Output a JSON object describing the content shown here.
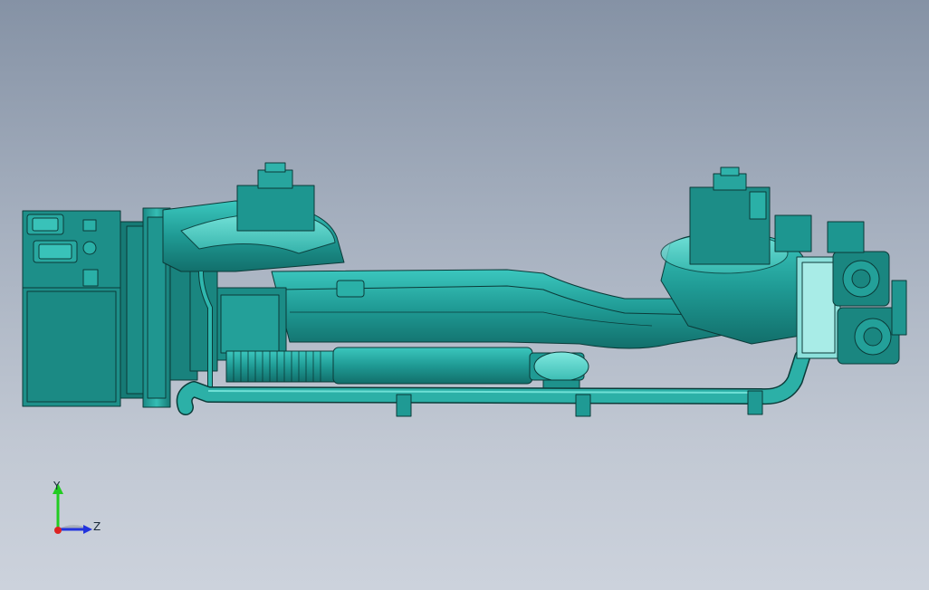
{
  "viewport": {
    "background_top": "#8592a5",
    "background_bottom": "#ccd2dc",
    "model_color": "#1f9a94",
    "edge_color": "#0b3a38"
  },
  "triad": {
    "y_label": "Y",
    "z_label": "Z",
    "y_color": "#22cc22",
    "z_color": "#2233dd",
    "origin_color": "#dd2222"
  }
}
